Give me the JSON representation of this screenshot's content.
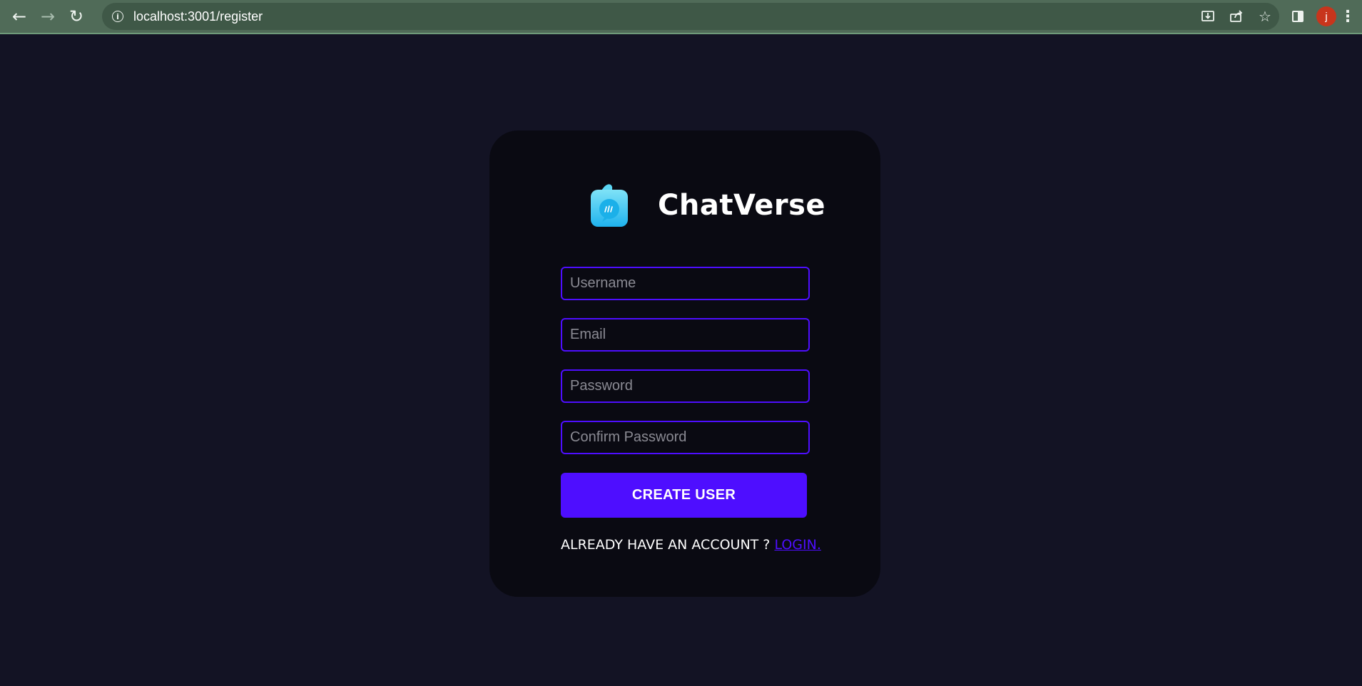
{
  "browser": {
    "url": "localhost:3001/register",
    "avatar_letter": "j",
    "icons": {
      "back": "arrow-left-icon",
      "forward": "arrow-right-icon",
      "reload": "reload-icon",
      "site_info": "info-icon",
      "install": "install-icon",
      "share": "share-icon",
      "bookmark": "star-icon",
      "side_panel": "side-panel-icon",
      "menu": "kebab-menu-icon"
    }
  },
  "brand": {
    "name": "ChatVerse",
    "logo_icon": "chat-bubble-logo-icon"
  },
  "form": {
    "username_placeholder": "Username",
    "email_placeholder": "Email",
    "password_placeholder": "Password",
    "confirm_placeholder": "Confirm Password",
    "submit_label": "CREATE USER",
    "account_prompt": "ALREADY HAVE AN ACCOUNT ?",
    "login_link": "LOGIN."
  },
  "colors": {
    "page_background": "#131324",
    "card_background": "#0a0a12",
    "accent": "#4e0eff",
    "browser_frame": "#506b58"
  }
}
